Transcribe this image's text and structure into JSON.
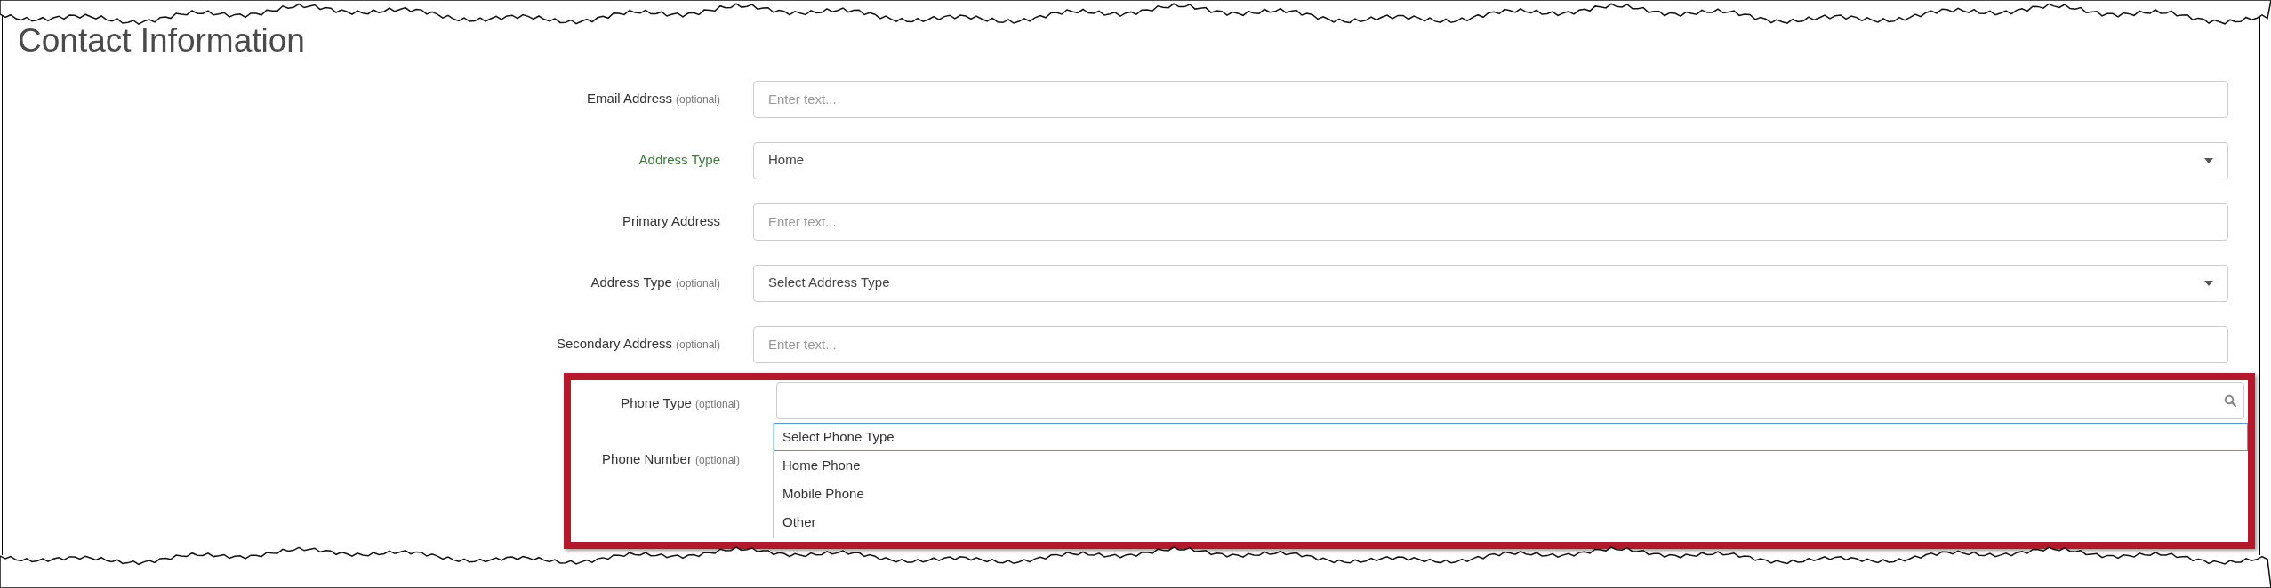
{
  "title": "Contact Information",
  "fields": [
    {
      "label": "Email Address",
      "note": "(optional)",
      "kind": "text",
      "placeholder": "Enter text...",
      "valid": false
    },
    {
      "label": "Address Type",
      "kind": "select",
      "value": "Home",
      "valid": true
    },
    {
      "label": "Primary Address",
      "kind": "text",
      "placeholder": "Enter text...",
      "valid": false
    },
    {
      "label": "Address Type",
      "note": "(optional)",
      "kind": "select",
      "value": "Select Address Type",
      "valid": false
    },
    {
      "label": "Secondary Address",
      "note": "(optional)",
      "kind": "text",
      "placeholder": "Enter text...",
      "valid": false
    }
  ],
  "highlighted_fields": {
    "labels": [
      {
        "label": "Phone Type",
        "note": "(optional)"
      },
      {
        "label": "Phone Number",
        "note": "(optional)"
      }
    ],
    "dropdown": {
      "expanded": true,
      "options": [
        {
          "label": "Select Phone Type",
          "selected": true
        },
        {
          "label": "Home Phone",
          "selected": false
        },
        {
          "label": "Mobile Phone",
          "selected": false
        },
        {
          "label": "Other",
          "selected": false
        }
      ]
    }
  }
}
